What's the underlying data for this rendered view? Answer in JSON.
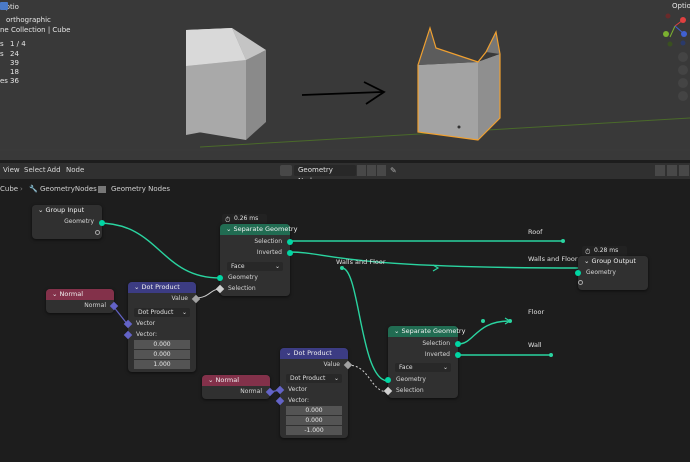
{
  "viewport": {
    "options_label": "Optio",
    "view_mode": "orthographic",
    "collection": "ne Collection | Cube",
    "stats": [
      {
        "label": "s",
        "value": "1 / 4"
      },
      {
        "label": "s",
        "value": "24"
      },
      {
        "label": "",
        "value": "39"
      },
      {
        "label": "",
        "value": "18"
      },
      {
        "label": "es",
        "value": "36"
      }
    ]
  },
  "editor_header": {
    "menu": [
      "View",
      "Select",
      "Add",
      "Node"
    ],
    "tree_name": "Geometry Nodes"
  },
  "breadcrumb": [
    "Cube",
    "GeometryNodes",
    "Geometry Nodes"
  ],
  "nodes": {
    "group_input": {
      "title": "Group Input",
      "geometry": "Geometry"
    },
    "separate1": {
      "timer": "0.26 ms",
      "title": "Separate Geometry",
      "selection_out": "Selection",
      "inverted_out": "Inverted",
      "mode": "Face",
      "geometry_in": "Geometry",
      "selection_in": "Selection"
    },
    "normal1": {
      "title": "Normal",
      "out": "Normal"
    },
    "dot1": {
      "title": "Dot Product",
      "value_out": "Value",
      "mode": "Dot Product",
      "vector": "Vector",
      "vector2": "Vector:",
      "vals": [
        "0.000",
        "0.000",
        "1.000"
      ]
    },
    "group_output": {
      "timer": "0.28 ms",
      "title": "Group Output",
      "geometry": "Geometry"
    },
    "separate2": {
      "title": "Separate Geometry",
      "selection_out": "Selection",
      "inverted_out": "Inverted",
      "mode": "Face",
      "geometry_in": "Geometry",
      "selection_in": "Selection"
    },
    "normal2": {
      "title": "Normal",
      "out": "Normal"
    },
    "dot2": {
      "title": "Dot Product",
      "value_out": "Value",
      "mode": "Dot Product",
      "vector": "Vector",
      "vector2": "Vector:",
      "vals": [
        "0.000",
        "0.000",
        "-1.000"
      ]
    }
  },
  "labels": {
    "roof": "Roof",
    "walls_floor_1": "Walls and Floor",
    "walls_floor_2": "Walls and Floor",
    "floor": "Floor",
    "wall": "Wall"
  },
  "colors": {
    "link": "#2ad4a0",
    "geometry_socket": "#00d6a3",
    "vector_socket": "#6363c7",
    "float_socket": "#a1a1a1",
    "selection": "#f5a442"
  }
}
